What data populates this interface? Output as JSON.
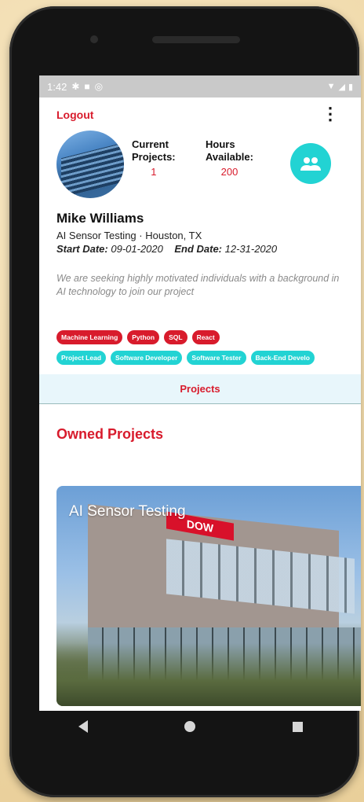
{
  "status": {
    "time": "1:42"
  },
  "header": {
    "logout_label": "Logout",
    "menu_icon": "more-vert-icon"
  },
  "profile": {
    "current_projects_label_1": "Current",
    "current_projects_label_2": "Projects:",
    "current_projects_value": "1",
    "hours_label_1": "Hours",
    "hours_label_2": "Available:",
    "hours_value": "200",
    "name": "Mike Williams",
    "role": "AI Sensor Testing",
    "location": "Houston, TX",
    "start_label": "Start Date:",
    "start_value": "09-01-2020",
    "end_label": "End Date:",
    "end_value": "12-31-2020",
    "description": "We are seeking highly motivated individuals with a background in AI technology to join our project"
  },
  "skills": [
    "Machine Learning",
    "Python",
    "SQL",
    "React"
  ],
  "roles": [
    "Project Lead",
    "Software Developer",
    "Software Tester",
    "Back-End Develo"
  ],
  "tabs": {
    "projects": "Projects"
  },
  "owned": {
    "section_title": "Owned Projects",
    "card_title": "AI Sensor Testing",
    "logo_text": "DOW"
  },
  "colors": {
    "accent": "#d81b2c",
    "teal": "#22d3d3"
  }
}
